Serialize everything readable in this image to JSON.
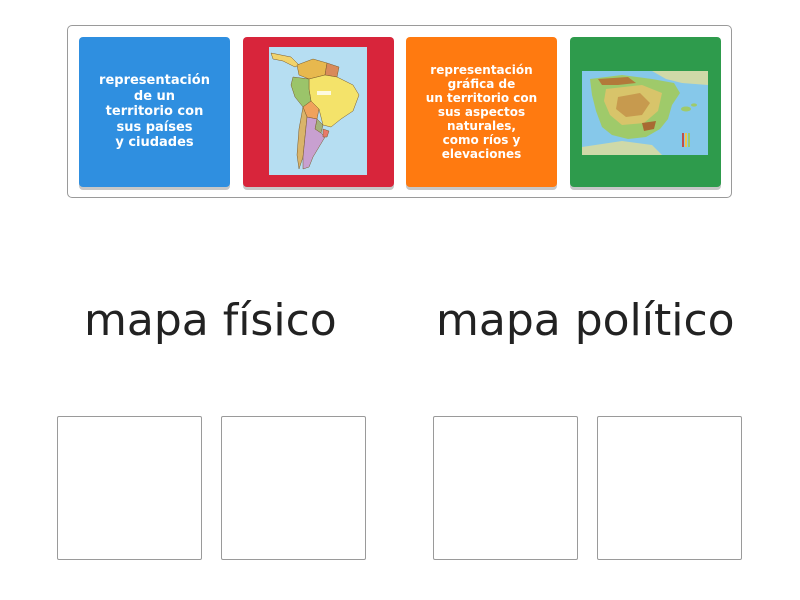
{
  "cards": [
    {
      "id": "c1",
      "type": "text",
      "color": "#2f8fe0",
      "text": "representación\nde un\nterritorio con\nsus países\ny ciudades"
    },
    {
      "id": "c2",
      "type": "image",
      "color": "#d8253b",
      "icon": "south-america-political-map"
    },
    {
      "id": "c3",
      "type": "text",
      "color": "#ff7a10",
      "text": "representación\ngráfica de\nun territorio con\nsus aspectos\nnaturales,\ncomo ríos y\nelevaciones"
    },
    {
      "id": "c4",
      "type": "image",
      "color": "#2e9b4c",
      "icon": "iberian-peninsula-physical-map"
    }
  ],
  "groups": [
    {
      "heading": "mapa físico"
    },
    {
      "heading": "mapa político"
    }
  ]
}
